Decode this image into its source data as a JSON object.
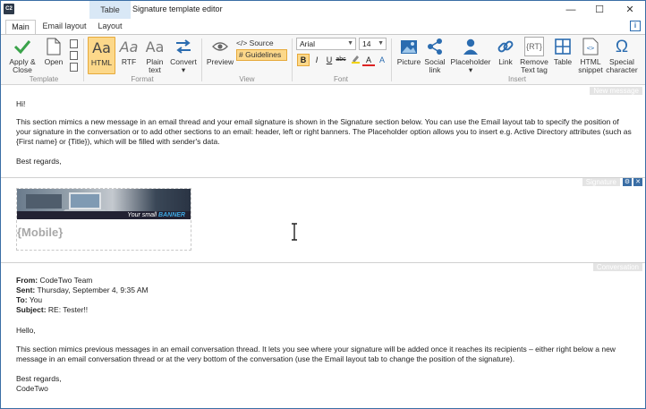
{
  "window": {
    "app_icon_text": "C2",
    "context_tab": "Table",
    "title": "Signature template editor",
    "controls": {
      "minimize": "—",
      "maximize": "☐",
      "close": "✕"
    }
  },
  "tabs": [
    {
      "label": "Main",
      "active": true
    },
    {
      "label": "Email layout",
      "active": false
    },
    {
      "label": "Layout",
      "active": false
    }
  ],
  "info_label": "i",
  "ribbon": {
    "template": {
      "label": "Template",
      "apply_close": "Apply & Close",
      "open": "Open"
    },
    "format": {
      "label": "Format",
      "html": "HTML",
      "rtf": "RTF",
      "plain_text": "Plain text",
      "convert": "Convert",
      "aa_glyph": "Aa"
    },
    "view": {
      "label": "View",
      "preview": "Preview",
      "source": "</> Source",
      "guidelines": "# Guidelines"
    },
    "font": {
      "label": "Font",
      "family": "Arial",
      "size": "14",
      "bold": "B",
      "italic": "I",
      "underline": "U",
      "strikethrough": "abc",
      "text_color": "A",
      "color_a": "A",
      "bold_selected": true
    },
    "insert": {
      "label": "Insert",
      "picture": "Picture",
      "social_link": "Social link",
      "placeholder": "Placeholder",
      "link": "Link",
      "remove_text_tag": "Remove Text tag",
      "table": "Table",
      "html_snippet": "HTML snippet",
      "special_character": "Special character",
      "rt_glyph": "{RT}",
      "snippet_glyph": "<>",
      "omega": "Ω"
    }
  },
  "editor": {
    "new_message": {
      "label": "New message",
      "greeting": "Hi!",
      "paragraph": "This section mimics a new message in an email thread and your email signature is shown in the Signature section below. You can use the Email layout tab to specify the position of your signature in the conversation or to add other sections to an email: header, left or right banners. The Placeholder option allows you to insert e.g. Active Directory attributes (such as {First name} or {Title}), which will be filled with sender's data.",
      "closing": "Best regards,"
    },
    "signature": {
      "label": "Signature",
      "gear": "⚙",
      "close": "✕",
      "banner_text_prefix": "Your small ",
      "banner_text_highlight": "BANNER",
      "mobile_placeholder": "{Mobile}"
    },
    "conversation": {
      "label": "Conversation",
      "from_label": "From:",
      "from_value": "CodeTwo Team",
      "sent_label": "Sent:",
      "sent_value": "Thursday, September 4, 9:35 AM",
      "to_label": "To:",
      "to_value": "You",
      "subject_label": "Subject:",
      "subject_value": "RE: Tester!!",
      "greeting": "Hello,",
      "paragraph": "This section mimics previous messages in an email conversation thread. It lets you see where your signature will be added once it reaches its recipients – either right below a new message in an email conversation thread or at the very bottom of the conversation (use the Email layout tab to change the position of the signature).",
      "closing_1": "Best regards,",
      "closing_2": "CodeTwo"
    }
  },
  "colors": {
    "accent_blue": "#2b6cb0",
    "selected_fill": "#fcd88a",
    "selected_border": "#e6a93a",
    "apply_green": "#3aa34a"
  }
}
